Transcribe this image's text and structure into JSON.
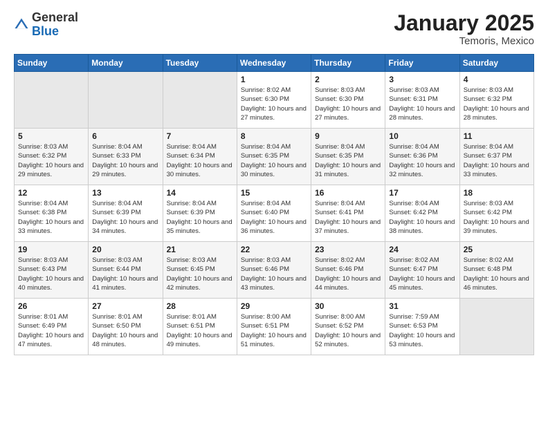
{
  "logo": {
    "general": "General",
    "blue": "Blue"
  },
  "title": "January 2025",
  "subtitle": "Temoris, Mexico",
  "weekdays": [
    "Sunday",
    "Monday",
    "Tuesday",
    "Wednesday",
    "Thursday",
    "Friday",
    "Saturday"
  ],
  "weeks": [
    [
      {
        "day": "",
        "empty": true
      },
      {
        "day": "",
        "empty": true
      },
      {
        "day": "",
        "empty": true
      },
      {
        "day": "1",
        "sunrise": "Sunrise: 8:02 AM",
        "sunset": "Sunset: 6:30 PM",
        "daylight": "Daylight: 10 hours and 27 minutes."
      },
      {
        "day": "2",
        "sunrise": "Sunrise: 8:03 AM",
        "sunset": "Sunset: 6:30 PM",
        "daylight": "Daylight: 10 hours and 27 minutes."
      },
      {
        "day": "3",
        "sunrise": "Sunrise: 8:03 AM",
        "sunset": "Sunset: 6:31 PM",
        "daylight": "Daylight: 10 hours and 28 minutes."
      },
      {
        "day": "4",
        "sunrise": "Sunrise: 8:03 AM",
        "sunset": "Sunset: 6:32 PM",
        "daylight": "Daylight: 10 hours and 28 minutes."
      }
    ],
    [
      {
        "day": "5",
        "sunrise": "Sunrise: 8:03 AM",
        "sunset": "Sunset: 6:32 PM",
        "daylight": "Daylight: 10 hours and 29 minutes."
      },
      {
        "day": "6",
        "sunrise": "Sunrise: 8:04 AM",
        "sunset": "Sunset: 6:33 PM",
        "daylight": "Daylight: 10 hours and 29 minutes."
      },
      {
        "day": "7",
        "sunrise": "Sunrise: 8:04 AM",
        "sunset": "Sunset: 6:34 PM",
        "daylight": "Daylight: 10 hours and 30 minutes."
      },
      {
        "day": "8",
        "sunrise": "Sunrise: 8:04 AM",
        "sunset": "Sunset: 6:35 PM",
        "daylight": "Daylight: 10 hours and 30 minutes."
      },
      {
        "day": "9",
        "sunrise": "Sunrise: 8:04 AM",
        "sunset": "Sunset: 6:35 PM",
        "daylight": "Daylight: 10 hours and 31 minutes."
      },
      {
        "day": "10",
        "sunrise": "Sunrise: 8:04 AM",
        "sunset": "Sunset: 6:36 PM",
        "daylight": "Daylight: 10 hours and 32 minutes."
      },
      {
        "day": "11",
        "sunrise": "Sunrise: 8:04 AM",
        "sunset": "Sunset: 6:37 PM",
        "daylight": "Daylight: 10 hours and 33 minutes."
      }
    ],
    [
      {
        "day": "12",
        "sunrise": "Sunrise: 8:04 AM",
        "sunset": "Sunset: 6:38 PM",
        "daylight": "Daylight: 10 hours and 33 minutes."
      },
      {
        "day": "13",
        "sunrise": "Sunrise: 8:04 AM",
        "sunset": "Sunset: 6:39 PM",
        "daylight": "Daylight: 10 hours and 34 minutes."
      },
      {
        "day": "14",
        "sunrise": "Sunrise: 8:04 AM",
        "sunset": "Sunset: 6:39 PM",
        "daylight": "Daylight: 10 hours and 35 minutes."
      },
      {
        "day": "15",
        "sunrise": "Sunrise: 8:04 AM",
        "sunset": "Sunset: 6:40 PM",
        "daylight": "Daylight: 10 hours and 36 minutes."
      },
      {
        "day": "16",
        "sunrise": "Sunrise: 8:04 AM",
        "sunset": "Sunset: 6:41 PM",
        "daylight": "Daylight: 10 hours and 37 minutes."
      },
      {
        "day": "17",
        "sunrise": "Sunrise: 8:04 AM",
        "sunset": "Sunset: 6:42 PM",
        "daylight": "Daylight: 10 hours and 38 minutes."
      },
      {
        "day": "18",
        "sunrise": "Sunrise: 8:03 AM",
        "sunset": "Sunset: 6:42 PM",
        "daylight": "Daylight: 10 hours and 39 minutes."
      }
    ],
    [
      {
        "day": "19",
        "sunrise": "Sunrise: 8:03 AM",
        "sunset": "Sunset: 6:43 PM",
        "daylight": "Daylight: 10 hours and 40 minutes."
      },
      {
        "day": "20",
        "sunrise": "Sunrise: 8:03 AM",
        "sunset": "Sunset: 6:44 PM",
        "daylight": "Daylight: 10 hours and 41 minutes."
      },
      {
        "day": "21",
        "sunrise": "Sunrise: 8:03 AM",
        "sunset": "Sunset: 6:45 PM",
        "daylight": "Daylight: 10 hours and 42 minutes."
      },
      {
        "day": "22",
        "sunrise": "Sunrise: 8:03 AM",
        "sunset": "Sunset: 6:46 PM",
        "daylight": "Daylight: 10 hours and 43 minutes."
      },
      {
        "day": "23",
        "sunrise": "Sunrise: 8:02 AM",
        "sunset": "Sunset: 6:46 PM",
        "daylight": "Daylight: 10 hours and 44 minutes."
      },
      {
        "day": "24",
        "sunrise": "Sunrise: 8:02 AM",
        "sunset": "Sunset: 6:47 PM",
        "daylight": "Daylight: 10 hours and 45 minutes."
      },
      {
        "day": "25",
        "sunrise": "Sunrise: 8:02 AM",
        "sunset": "Sunset: 6:48 PM",
        "daylight": "Daylight: 10 hours and 46 minutes."
      }
    ],
    [
      {
        "day": "26",
        "sunrise": "Sunrise: 8:01 AM",
        "sunset": "Sunset: 6:49 PM",
        "daylight": "Daylight: 10 hours and 47 minutes."
      },
      {
        "day": "27",
        "sunrise": "Sunrise: 8:01 AM",
        "sunset": "Sunset: 6:50 PM",
        "daylight": "Daylight: 10 hours and 48 minutes."
      },
      {
        "day": "28",
        "sunrise": "Sunrise: 8:01 AM",
        "sunset": "Sunset: 6:51 PM",
        "daylight": "Daylight: 10 hours and 49 minutes."
      },
      {
        "day": "29",
        "sunrise": "Sunrise: 8:00 AM",
        "sunset": "Sunset: 6:51 PM",
        "daylight": "Daylight: 10 hours and 51 minutes."
      },
      {
        "day": "30",
        "sunrise": "Sunrise: 8:00 AM",
        "sunset": "Sunset: 6:52 PM",
        "daylight": "Daylight: 10 hours and 52 minutes."
      },
      {
        "day": "31",
        "sunrise": "Sunrise: 7:59 AM",
        "sunset": "Sunset: 6:53 PM",
        "daylight": "Daylight: 10 hours and 53 minutes."
      },
      {
        "day": "",
        "empty": true
      }
    ]
  ]
}
